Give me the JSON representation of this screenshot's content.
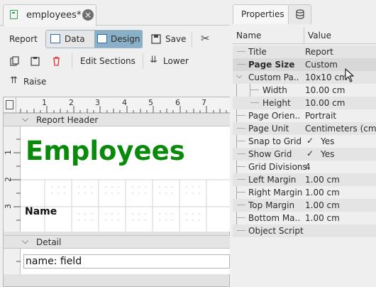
{
  "document_tab": {
    "title": "employees*"
  },
  "toolbar": {
    "report_label": "Report",
    "data_label": "Data",
    "design_label": "Design",
    "save_label": "Save",
    "edit_sections_label": "Edit Sections",
    "lower_label": "Lower",
    "raise_label": "Raise"
  },
  "ruler": {
    "marks": [
      "1",
      "2",
      "3",
      "4",
      "5",
      "6",
      "7"
    ],
    "vmarks": [
      "1",
      "2",
      "3"
    ]
  },
  "bands": {
    "report_header": "Report Header",
    "detail": "Detail"
  },
  "canvas": {
    "title_text": "Employees",
    "name_label": "Name",
    "field_text": "name: field"
  },
  "properties": {
    "tab_label": "Properties",
    "col_name": "Name",
    "col_value": "Value",
    "rows": [
      {
        "name": "Title",
        "value": "Report"
      },
      {
        "name": "Page Size",
        "value": "Custom"
      },
      {
        "name": "Custom Pa...",
        "value": "10x10 cm"
      },
      {
        "name": "Width",
        "value": "10.00 cm"
      },
      {
        "name": "Height",
        "value": "10.00 cm"
      },
      {
        "name": "Page Orien...",
        "value": "Portrait"
      },
      {
        "name": "Page Unit",
        "value": "Centimeters (cm)"
      },
      {
        "name": "Snap to Grid",
        "value": "Yes"
      },
      {
        "name": "Show Grid",
        "value": "Yes"
      },
      {
        "name": "Grid Divisions",
        "value": "4"
      },
      {
        "name": "Left Margin",
        "value": "1.00 cm"
      },
      {
        "name": "Right Margin",
        "value": "1.00 cm"
      },
      {
        "name": "Top Margin",
        "value": "1.00 cm"
      },
      {
        "name": "Bottom Ma...",
        "value": "1.00 cm"
      },
      {
        "name": "Object Script",
        "value": ""
      }
    ]
  },
  "colors": {
    "title_green": "#0a8a0a",
    "active_segment": "#8ab0c8"
  }
}
